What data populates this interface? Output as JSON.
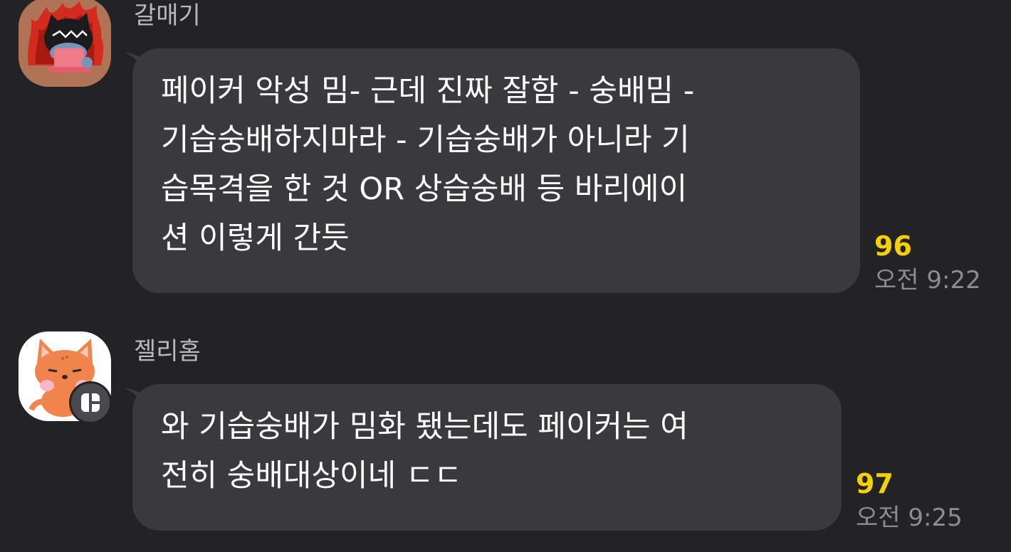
{
  "messages": [
    {
      "sender": "갈매기",
      "avatar_icon": "angry-cat-laptop-avatar-icon",
      "lines": [
        "페이커 악성 밈- 근데 진짜 잘함 - 숭배밈 -",
        "기습숭배하지마라 - 기습숭배가 아니라 기",
        "습목격을 한 것 OR 상습숭배 등 바리에이",
        "션 이렇게 간듯"
      ],
      "unread_count": "96",
      "time": "오전 9:22"
    },
    {
      "sender": "젤리홈",
      "avatar_icon": "orange-fox-avatar-icon",
      "badge_icon": "app-badge-icon",
      "lines": [
        "와 기습숭배가 밈화 됐는데도 페이커는 여",
        "전히 숭배대상이네 ㄷㄷ"
      ],
      "unread_count": "97",
      "time": "오전 9:25"
    }
  ],
  "colors": {
    "background": "#232325",
    "bubble": "#3a3a3d",
    "unread": "#f5d100",
    "time": "#8d8d90",
    "sender": "#b9b9bb"
  }
}
